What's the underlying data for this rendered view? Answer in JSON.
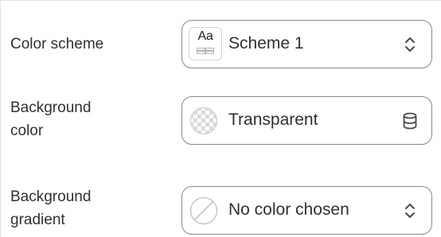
{
  "settings": {
    "color_scheme": {
      "label": "Color scheme",
      "value": "Scheme 1",
      "preview_text": "Aa",
      "icon": "scheme-preview-icon",
      "trailing_icon": "select-arrows-icon"
    },
    "background_color": {
      "label_line1": "Background",
      "label_line2": "color",
      "value": "Transparent",
      "icon": "transparent-checker-icon",
      "trailing_icon": "database-icon"
    },
    "background_gradient": {
      "label_line1": "Background",
      "label_line2": "gradient",
      "value": "No color chosen",
      "icon": "no-color-icon",
      "trailing_icon": "select-arrows-icon"
    }
  },
  "colors": {
    "text": "#303030",
    "border": "#8a8a8a",
    "panel_background": "#ffffff",
    "page_background": "#f5f5f5"
  }
}
